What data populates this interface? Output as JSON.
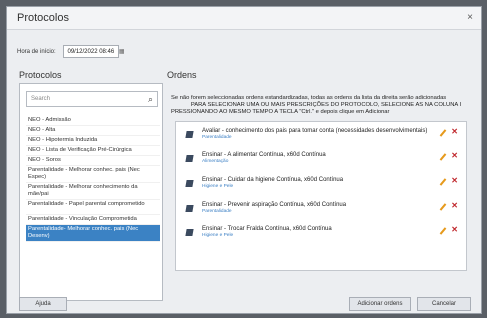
{
  "dialog": {
    "title": "Protocolos",
    "close_glyph": "×"
  },
  "start_time": {
    "label": "Hora de início:",
    "value": "09/12/2022 08:46",
    "calendar_glyph": "▦"
  },
  "protocols": {
    "title": "Protocolos",
    "search_placeholder": "Search",
    "items": [
      "NEO - Admissão",
      "NEO - Alta",
      "NEO - Hipotermia Induzida",
      "NEO - Lista de Verificação Pré-Cirúrgica",
      "NEO - Soros",
      "Parentalidade - Melhorar conhec. pais (Nec Espec)",
      "Parentalidade - Melhorar conhecimento da mãe/pai",
      "Parentalidade - Papel parental comprometido",
      "Parentalidade - Vinculação Comprometida",
      "Parentalidade- Melhorar conhec. pais (Nec Desenv)"
    ]
  },
  "orders": {
    "title": "Ordens",
    "notice_line1": "Se não forem seleccionadas ordens estandardizadas, todas as ordens da lista da direita serão adicionadas",
    "notice_line2": "PARA SELECIONAR UMA OU MAIS PRESCRIÇÕES DO PROTOCOLO, SELECIONE AS NA COLUNA I",
    "notice_line3": "PRESSIONANDO AO MESMO TEMPO A TECLA \"Ctrl.\" e depois clique em Adicionar",
    "items": [
      {
        "main": "Avaliar - conhecimento dos pais para tomar conta (necessidades desenvolvimentais)",
        "sub": "Parentalidade"
      },
      {
        "main": "Ensinar - A alimentar    Contínua, x60d Contínua",
        "sub": "Alimentação"
      },
      {
        "main": "Ensinar - Cuidar da higiene    Contínua, x60d Contínua",
        "sub": "Higiene e Pele"
      },
      {
        "main": "Ensinar - Prevenir aspiração    Contínua, x60d Contínua",
        "sub": "Parentalidade"
      },
      {
        "main": "Ensinar - Trocar Fralda    Contínua, x60d Contínua",
        "sub": "Higiene e Pele"
      }
    ]
  },
  "buttons": {
    "help": "Ajuda",
    "add": "Adicionar ordens",
    "cancel": "Cancelar"
  },
  "colors": {
    "selected": "#3b82c4",
    "edit": "#e69a1c",
    "delete": "#c0282d"
  }
}
